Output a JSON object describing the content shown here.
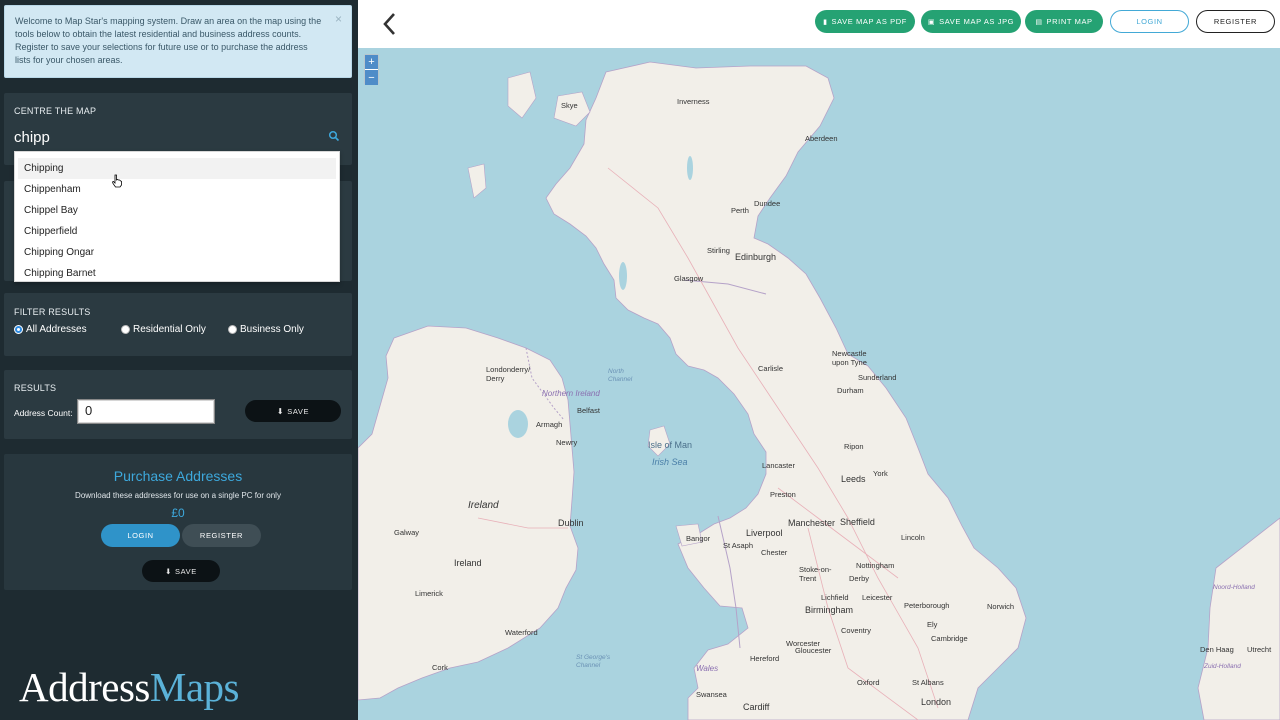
{
  "info": {
    "text": "Welcome to Map Star's mapping system. Draw an area on the map using the tools below to obtain the latest residential and business address counts. Register to save your selections for future use or to purchase the address lists for your chosen areas.",
    "close": "×"
  },
  "centre": {
    "title": "CENTRE THE MAP",
    "search_value": "chipp",
    "suggestions": [
      "Chipping",
      "Chippenham",
      "Chippel Bay",
      "Chipperfield",
      "Chipping Ongar",
      "Chipping Barnet"
    ]
  },
  "filter": {
    "title": "FILTER RESULTS",
    "options": [
      "All Addresses",
      "Residential Only",
      "Business Only"
    ],
    "selected": "All Addresses"
  },
  "results": {
    "title": "RESULTS",
    "count_label": "Address Count:",
    "count_value": "0",
    "save_label": "SAVE"
  },
  "purchase": {
    "title": "Purchase Addresses",
    "description": "Download these addresses for use on a single PC for only",
    "price": "£0",
    "login_label": "LOGIN",
    "register_label": "REGISTER",
    "save_label": "SAVE"
  },
  "logo": {
    "part1": "Address",
    "part2": "Maps"
  },
  "toolbar": {
    "save_pdf": "SAVE MAP AS PDF",
    "save_jpg": "SAVE MAP AS JPG",
    "print": "PRINT MAP",
    "login": "LOGIN",
    "register": "REGISTER"
  },
  "map": {
    "zoom_in": "+",
    "zoom_out": "−",
    "places": {
      "skye": "Skye",
      "inverness": "Inverness",
      "aberdeen": "Aberdeen",
      "perth": "Perth",
      "dundee": "Dundee",
      "stirling": "Stirling",
      "edinburgh": "Edinburgh",
      "glasgow": "Glasgow",
      "londonderry": "Londonderry/ Derry",
      "belfast": "Belfast",
      "armagh": "Armagh",
      "newry": "Newry",
      "newcastle": "Newcastle upon Tyne",
      "sunderland": "Sunderland",
      "carlisle": "Carlisle",
      "durham": "Durham",
      "ripon": "Ripon",
      "lancaster": "Lancaster",
      "york": "York",
      "leeds": "Leeds",
      "preston": "Preston",
      "manchester": "Manchester",
      "sheffield": "Sheffield",
      "liverpool": "Liverpool",
      "lincoln": "Lincoln",
      "bangor": "Bangor",
      "st_asaph": "St Asaph",
      "chester": "Chester",
      "stoke": "Stoke-on- Trent",
      "derby": "Derby",
      "nottingham": "Nottingham",
      "lichfield": "Lichfield",
      "leicester": "Leicester",
      "birmingham": "Birmingham",
      "peterborough": "Peterborough",
      "norwich": "Norwich",
      "ely": "Ely",
      "coventry": "Coventry",
      "worcester": "Worcester",
      "cambridge": "Cambridge",
      "hereford": "Hereford",
      "gloucester": "Gloucester",
      "oxford": "Oxford",
      "st_albans": "St Albans",
      "swansea": "Swansea",
      "cardiff": "Cardiff",
      "london": "London",
      "galway": "Galway",
      "dublin": "Dublin",
      "limerick": "Limerick",
      "waterford": "Waterford",
      "cork": "Cork",
      "den_haag": "Den Haag",
      "utrecht": "Utrecht"
    },
    "regions": {
      "ireland_island": "Ireland",
      "ireland_country": "Ireland",
      "northern_ireland": "Northern Ireland",
      "wales": "Wales",
      "isle_of_man": "Isle of Man",
      "irish_sea": "Irish Sea",
      "north_channel": "North Channel",
      "st_georges_channel": "St George's Channel",
      "noord_holland": "Noord-Holland",
      "zuid_holland": "Zuid-Holland"
    }
  }
}
